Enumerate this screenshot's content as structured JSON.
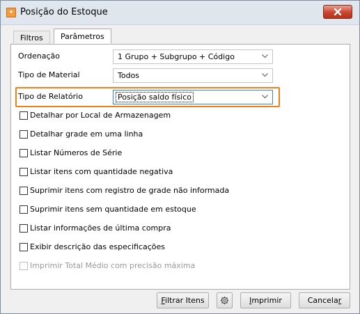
{
  "window": {
    "title": "Posição do Estoque"
  },
  "tabs": [
    {
      "label": "Filtros"
    },
    {
      "label": "Parâmetros"
    }
  ],
  "fields": {
    "ordenacao": {
      "label": "Ordenação",
      "value": "1 Grupo + Subgrupo + Código"
    },
    "tipo_material": {
      "label": "Tipo de Material",
      "value": "Todos"
    },
    "tipo_relatorio": {
      "label": "Tipo de Relatório",
      "value": "Posição saldo físico"
    }
  },
  "checkboxes": [
    {
      "label": "Detalhar por Local de Armazenagem",
      "checked": false,
      "enabled": true
    },
    {
      "label": "Detalhar grade em uma linha",
      "checked": false,
      "enabled": true
    },
    {
      "label": "Listar Números de Série",
      "checked": false,
      "enabled": true
    },
    {
      "label": "Listar itens com quantidade negativa",
      "checked": false,
      "enabled": true
    },
    {
      "label": "Suprimir itens com registro de grade não informada",
      "checked": false,
      "enabled": true
    },
    {
      "label": "Suprimir itens sem quantidade em estoque",
      "checked": false,
      "enabled": true
    },
    {
      "label": "Listar informações de última compra",
      "checked": false,
      "enabled": true
    },
    {
      "label": "Exibir descrição das especificações",
      "checked": false,
      "enabled": true
    },
    {
      "label": "Imprimir Total Médio com precisão máxima",
      "checked": false,
      "enabled": false
    }
  ],
  "buttons": {
    "filtrar": {
      "label_first": "F",
      "label_rest": "iltrar Itens"
    },
    "imprimir": {
      "label_first": "I",
      "label_rest": "mprimir"
    },
    "cancelar": {
      "label_start": "Cancela",
      "label_underlined": "r"
    }
  },
  "colors": {
    "highlight": "#f0801a",
    "close_button": "#c9452f"
  }
}
